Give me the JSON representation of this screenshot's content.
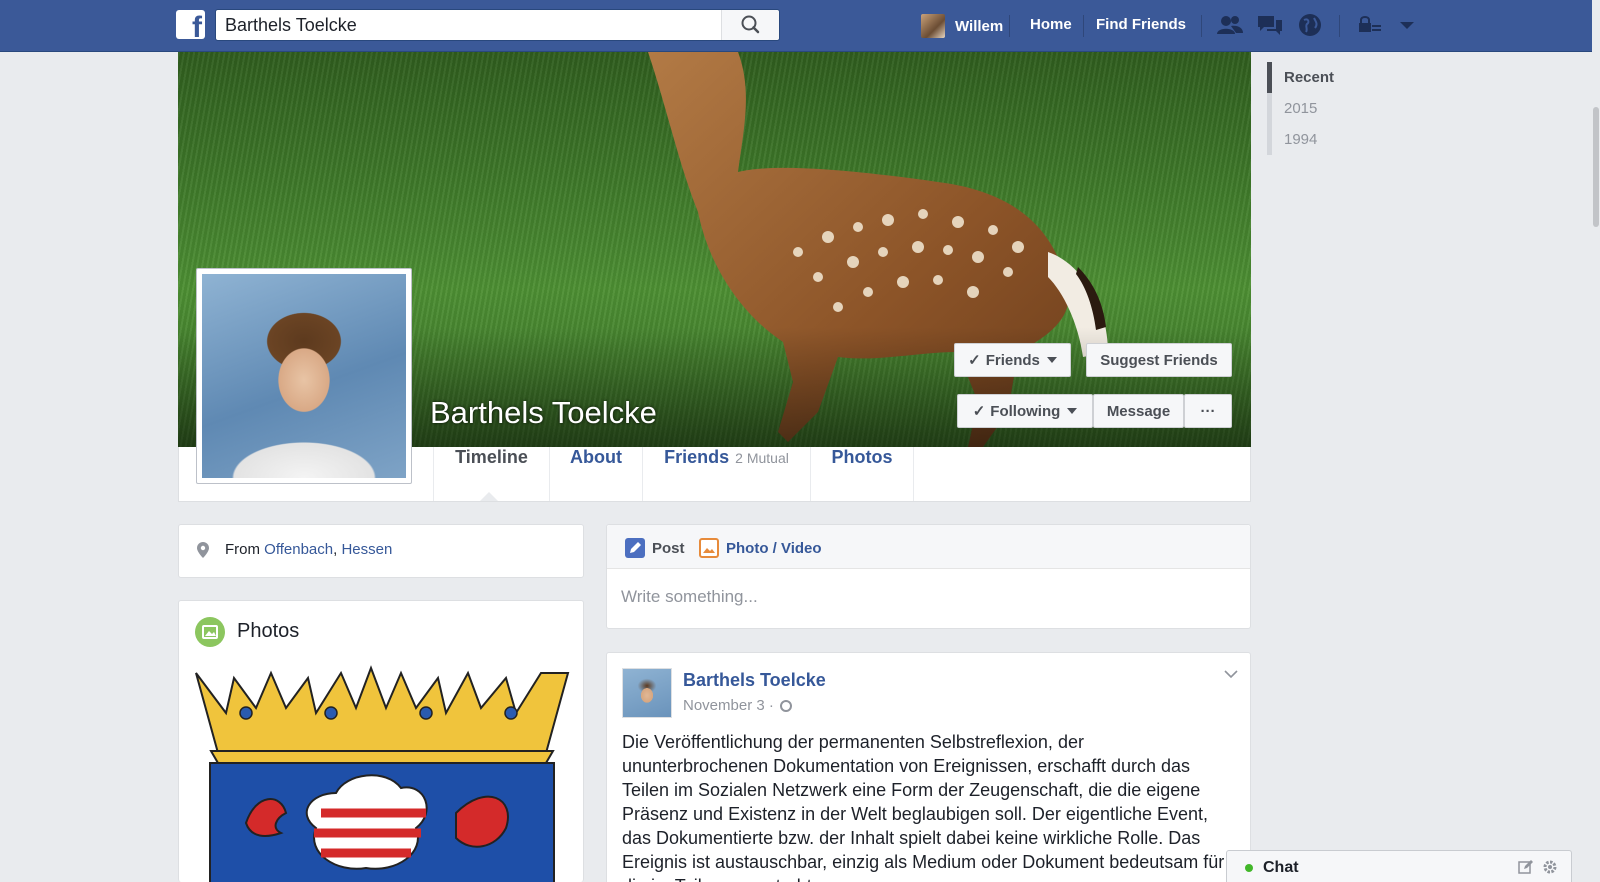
{
  "header": {
    "search_value": "Barthels Toelcke",
    "user_name": "Willem",
    "home_label": "Home",
    "find_friends_label": "Find Friends"
  },
  "timeline_nav": {
    "years": [
      "Recent",
      "2015",
      "1994"
    ]
  },
  "profile": {
    "name": "Barthels Toelcke",
    "buttons": {
      "friends": "Friends",
      "suggest_friends": "Suggest Friends",
      "following": "Following",
      "message": "Message",
      "more": "···"
    },
    "tabs": {
      "timeline": "Timeline",
      "about": "About",
      "friends": "Friends",
      "friends_mutual": "2 Mutual",
      "photos": "Photos"
    }
  },
  "intro": {
    "from_label": "From",
    "city": "Offenbach",
    "separator": ",",
    "region": "Hessen"
  },
  "photos_card": {
    "title": "Photos"
  },
  "composer": {
    "post_tab": "Post",
    "photo_tab": "Photo / Video",
    "placeholder": "Write something..."
  },
  "post": {
    "author": "Barthels Toelcke",
    "date": "November 3 ·",
    "text": "Die Veröffentlichung der permanenten Selbstreflexion, der ununterbrochenen Dokumentation von Ereignissen, erschafft durch das Teilen im Sozialen Netzwerk eine Form der Zeugenschaft, die die eigene Präsenz und Existenz in der Welt beglaubigen soll. Der eigentliche Event, das Dokumentierte bzw. der Inhalt spielt dabei keine wirkliche Rolle. Das Ereignis ist austauschbar, einzig als Medium oder Dokument bedeutsam für die im Teilen angestrebte"
  },
  "chat": {
    "label": "Chat"
  },
  "colors": {
    "brand_blue": "#3b5998",
    "link_blue": "#365899",
    "online_green": "#42b72a"
  },
  "icons": {
    "logo": "facebook-logo-icon",
    "search": "search-icon",
    "friend_requests": "friend-requests-icon",
    "messages": "messages-icon",
    "notifications": "globe-icon",
    "privacy": "privacy-lock-icon",
    "account": "chevron-down-icon",
    "location": "map-pin-icon",
    "photos": "photo-icon",
    "post": "pencil-icon",
    "photo_video": "camera-icon",
    "audience": "globe-icon",
    "post_options": "chevron-down-icon",
    "chat_compose": "compose-icon",
    "chat_settings": "gear-icon"
  }
}
